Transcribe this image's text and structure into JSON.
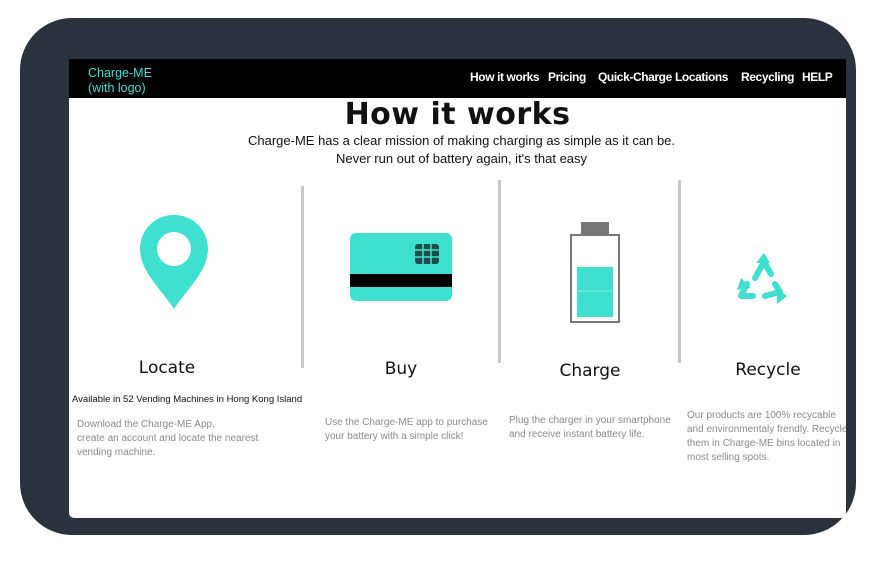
{
  "brand": {
    "line1": "Charge-ME",
    "line2": "(with logo)"
  },
  "nav": [
    {
      "label": "How it works"
    },
    {
      "label": "Pricing"
    },
    {
      "label": "Quick-Charge"
    },
    {
      "label": "Locations"
    },
    {
      "label": "Recycling"
    },
    {
      "label": "HELP"
    }
  ],
  "hero": {
    "title": "How it works",
    "subtitle_line1": "Charge-ME has a clear mission of making charging as simple as it can be.",
    "subtitle_line2": "Never run out of battery again, it's that easy"
  },
  "features": [
    {
      "icon": "location-pin-icon",
      "title": "Locate",
      "note": "Available in 52 Vending Machines in Hong Kong Island",
      "description": [
        "Download the Charge-ME App,",
        "create an account and  locate the nearest",
        "vending machine."
      ]
    },
    {
      "icon": "credit-card-icon",
      "title": "Buy",
      "description": [
        "Use the Charge-ME app to purchase",
        "your battery with a simple click!"
      ]
    },
    {
      "icon": "battery-icon",
      "title": "Charge",
      "description": [
        "Plug the charger in your smartphone",
        "and receive instant battery life."
      ]
    },
    {
      "icon": "recycle-icon",
      "title": "Recycle",
      "description": [
        "Our products are 100% recycable",
        "and environmentaly frendly. Recycle",
        "them in Charge-ME bins located in",
        "most selling spots."
      ]
    }
  ],
  "colors": {
    "accent": "#40e0d0",
    "navbar": "#000000",
    "device_frame": "#2b323d",
    "description_text": "#8a8a8a"
  }
}
